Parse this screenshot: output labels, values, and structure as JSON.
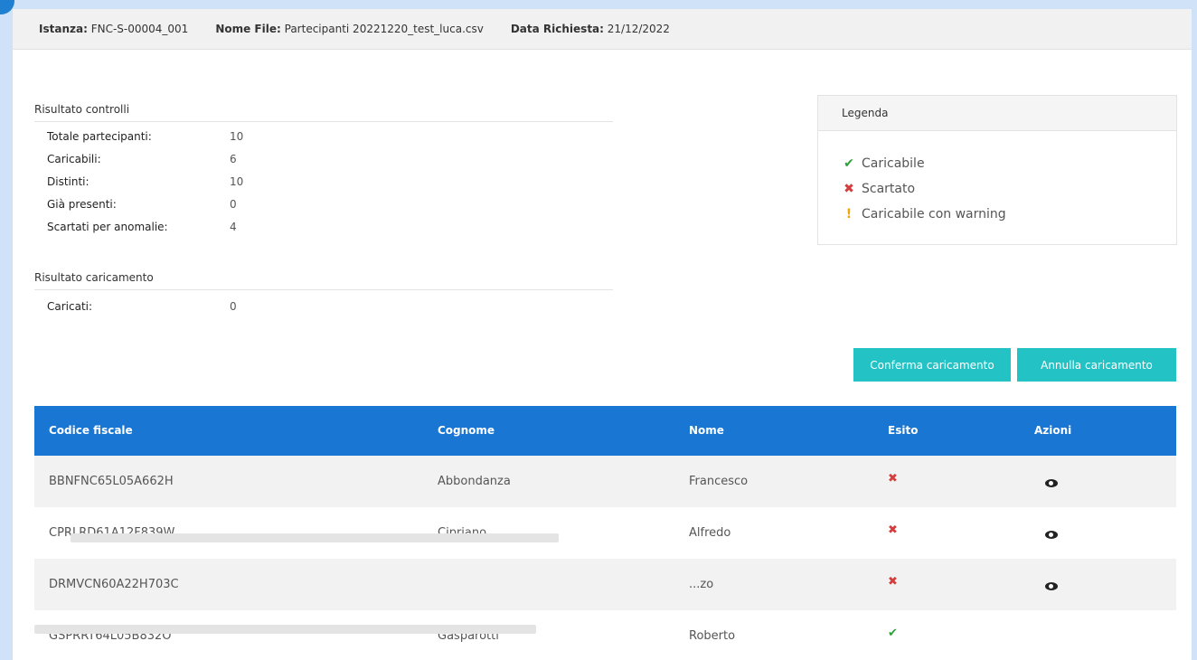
{
  "info": {
    "istanza_label": "Istanza:",
    "istanza_value": "FNC-S-00004_001",
    "file_label": "Nome File:",
    "file_value": "Partecipanti 20221220_test_luca.csv",
    "data_label": "Data Richiesta:",
    "data_value": "21/12/2022"
  },
  "controlli": {
    "title": "Risultato controlli",
    "rows": [
      {
        "label": "Totale partecipanti:",
        "value": "10"
      },
      {
        "label": "Caricabili:",
        "value": "6"
      },
      {
        "label": "Distinti:",
        "value": "10"
      },
      {
        "label": "Già presenti:",
        "value": "0"
      },
      {
        "label": "Scartati per anomalie:",
        "value": "4"
      }
    ]
  },
  "caricamento": {
    "title": "Risultato caricamento",
    "rows": [
      {
        "label": "Caricati:",
        "value": "0"
      }
    ]
  },
  "legenda": {
    "title": "Legenda",
    "items": [
      {
        "icon": "check-icon",
        "glyph": "✔",
        "label": "Caricabile"
      },
      {
        "icon": "cross-icon",
        "glyph": "✖",
        "label": "Scartato"
      },
      {
        "icon": "warning-icon",
        "glyph": "!",
        "label": "Caricabile con warning"
      }
    ]
  },
  "actions": {
    "confirm": "Conferma caricamento",
    "cancel": "Annulla caricamento"
  },
  "table": {
    "headers": [
      "Codice fiscale",
      "Cognome",
      "Nome",
      "Esito",
      "Azioni"
    ],
    "rows": [
      {
        "cf": "BBNFNC65L05A662H",
        "cognome": "Abbondanza",
        "nome": "Francesco",
        "esito": "✖",
        "azioni": "eye-icon"
      },
      {
        "cf": "CPRLRD61A12F839W",
        "cognome": "Cipriano",
        "nome": "Alfredo",
        "esito": "✖",
        "azioni": "eye-icon"
      },
      {
        "cf": "DRMVCN60A22H703C",
        "cognome": "",
        "nome": "...zo",
        "esito": "✖",
        "azioni": "eye-icon"
      },
      {
        "cf": "GSPRRT64L05B832O",
        "cognome": "Gasparotti",
        "nome": "Roberto",
        "esito": "✔",
        "azioni": ""
      }
    ]
  },
  "colors": {
    "header_blue": "#1976d2",
    "button_teal": "#22c2c5",
    "ok": "#2e9e3a",
    "ko": "#d43d3d",
    "warn": "#f0a500"
  }
}
